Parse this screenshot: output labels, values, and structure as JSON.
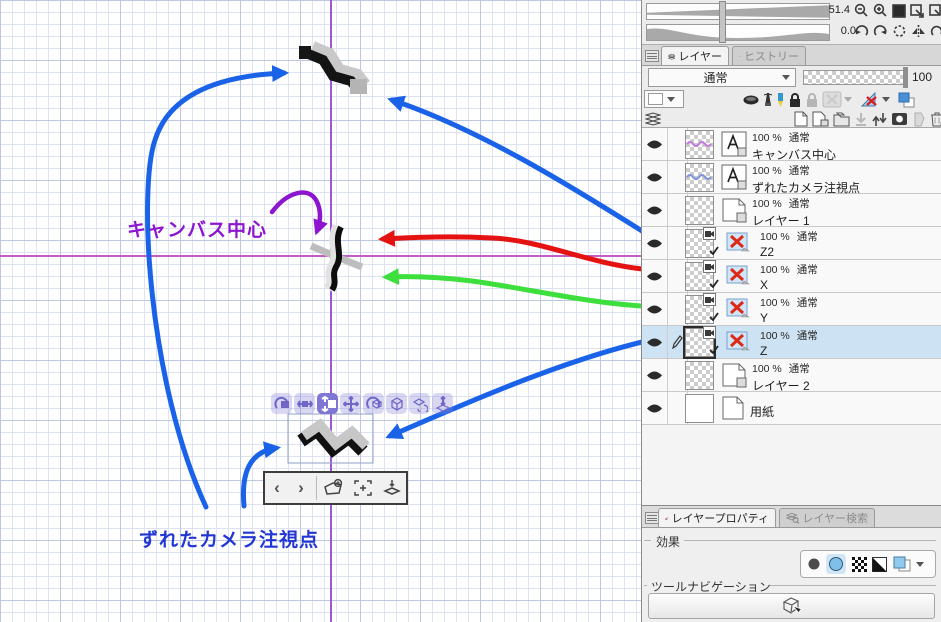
{
  "navigator": {
    "zoom_value": "51.4",
    "rotation_value": "0.0"
  },
  "canvas": {
    "canvas_center_label": "キャンバス中心",
    "camera_point_label": "ずれたカメラ注視点"
  },
  "layers_panel": {
    "tab_layers": "レイヤー",
    "tab_history": "ヒストリー",
    "blend_mode": "通常",
    "opacity_value": "100",
    "layers": [
      {
        "percent": "100 %",
        "mode": "通常",
        "name": "キャンバス中心",
        "type": "text"
      },
      {
        "percent": "100 %",
        "mode": "通常",
        "name": "ずれたカメラ注視点",
        "type": "text"
      },
      {
        "percent": "100 %",
        "mode": "通常",
        "name": "レイヤー 1",
        "type": "raster"
      },
      {
        "percent": "100 %",
        "mode": "通常",
        "name": "Z2",
        "type": "3d"
      },
      {
        "percent": "100 %",
        "mode": "通常",
        "name": "X",
        "type": "3d"
      },
      {
        "percent": "100 %",
        "mode": "通常",
        "name": "Y",
        "type": "3d"
      },
      {
        "percent": "100 %",
        "mode": "通常",
        "name": "Z",
        "type": "3d",
        "selected": true
      },
      {
        "percent": "100 %",
        "mode": "通常",
        "name": "レイヤー 2",
        "type": "raster"
      },
      {
        "name": "用紙",
        "type": "paper"
      }
    ]
  },
  "properties_panel": {
    "tab_property": "レイヤープロパティ",
    "tab_search": "レイヤー検索",
    "effects_label": "効果",
    "tool_navigation_label": "ツールナビゲーション"
  },
  "colors": {
    "arrow_blue": "#1a63e8",
    "arrow_red": "#e51212",
    "arrow_green": "#3ddf3d",
    "annotation_purple": "#8d15cf",
    "annotation_blue": "#2236d4",
    "selected_layer_bg": "#cde2f3"
  }
}
